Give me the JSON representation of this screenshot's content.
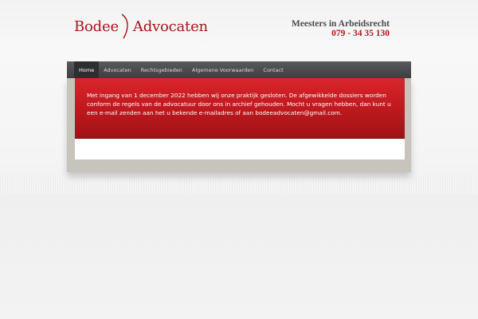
{
  "header": {
    "logo_left": "Bodee",
    "logo_right": "Advocaten",
    "tagline": "Meesters in Arbeidsrecht",
    "phone": "079 - 34 35 130"
  },
  "nav": {
    "items": [
      {
        "label": "Home",
        "active": true
      },
      {
        "label": "Advocaten",
        "active": false
      },
      {
        "label": "Rechtsgebieden",
        "active": false
      },
      {
        "label": "Algemene Voorwaarden",
        "active": false
      },
      {
        "label": "Contact",
        "active": false
      }
    ]
  },
  "notice": {
    "text": "Met ingang van 1 december 2022 hebben wij onze praktijk gesloten. De afgewikkelde dossiers worden conform de regels van de advocatuur door ons in archief gehouden. Mocht u vragen hebben, dan kunt u een e-mail zenden aan het u bekende e-mailadres of aan bodeeadvocaten@gmail.com."
  },
  "colors": {
    "brand_red": "#a8141a",
    "nav_bg": "#46464a",
    "notice_bg": "#c21a1f"
  }
}
